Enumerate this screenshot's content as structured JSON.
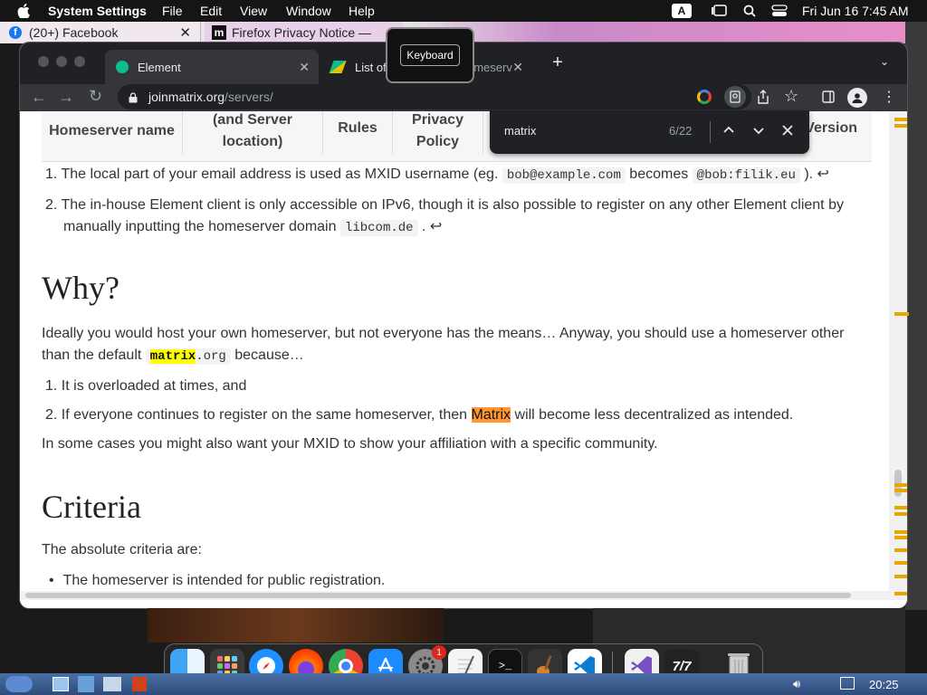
{
  "menubar": {
    "app_name": "System Settings",
    "menus": [
      "File",
      "Edit",
      "View",
      "Window",
      "Help"
    ],
    "input_indicator": "A",
    "datetime": "Fri Jun 16  7:45 AM"
  },
  "bg_tabs": {
    "facebook": {
      "title": "(20+) Facebook"
    },
    "firefox": {
      "title": "Firefox Privacy Notice —"
    }
  },
  "tooltip": {
    "label": "Keyboard"
  },
  "browser": {
    "tabs": [
      {
        "title": "Element",
        "active": true
      },
      {
        "title": "List of",
        "tail": "omeserv",
        "active": false
      }
    ],
    "url": {
      "domain": "joinmatrix.org",
      "path": "/servers/"
    }
  },
  "find": {
    "query": "matrix",
    "count": "6/22"
  },
  "page": {
    "table_headers": [
      {
        "text": "Homeserver name"
      },
      {
        "text": "(and Server location)"
      },
      {
        "text": "Rules"
      },
      {
        "text": "Privacy Policy"
      },
      {
        "text": "Version"
      }
    ],
    "notes": [
      {
        "num": "1.",
        "pre": "The local part of your email address is used as MXID username (eg. ",
        "code1": "bob@example.com",
        "mid": " becomes ",
        "code2": "@bob:filik.eu",
        "post": " ). ↩"
      },
      {
        "num": "2.",
        "line1": "The in-house Element client is only accessible on IPv6, though it is also possible to register on any other Element client by",
        "line2_pre": "manually inputting the homeserver domain ",
        "code": "libcom.de",
        "line2_post": " . ↩"
      }
    ],
    "why": {
      "heading": "Why?",
      "para_line1": "Ideally you would host your own homeserver, but not everyone has the means… Anyway, you should use a homeserver other",
      "para_line2_pre": "than the default ",
      "code_highlight": "matrix",
      "code_rest": ".org",
      "para_line2_post": " because…",
      "items": [
        {
          "num": "1.",
          "text": "It is overloaded at times, and"
        },
        {
          "num": "2.",
          "pre": "If everyone continues to register on the same homeserver, then ",
          "hl": "Matrix",
          "post": " will become less decentralized as intended."
        }
      ],
      "closing": "In some cases you might also want your MXID to show your affiliation with a specific community."
    },
    "criteria": {
      "heading": "Criteria",
      "intro": "The absolute criteria are:",
      "items": [
        "The homeserver is intended for public registration."
      ]
    }
  },
  "dock": {
    "badge": "1",
    "apps": [
      "finder",
      "launchpad",
      "safari",
      "firefox",
      "chrome",
      "app-store",
      "system-settings",
      "textedit",
      "terminal",
      "garageband",
      "vscode",
      "visual-studio",
      "tasks",
      "trash"
    ]
  },
  "taskbar": {
    "time": "20:25"
  },
  "colors": {
    "highlight_current": "#ff9632",
    "highlight_other": "#ffff00",
    "chrome_dark": "#202124"
  }
}
